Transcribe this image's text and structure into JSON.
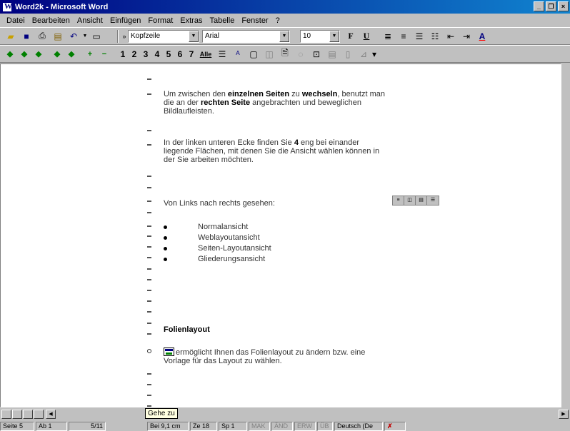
{
  "window": {
    "title": "Word2k - Microsoft Word"
  },
  "menu": [
    "Datei",
    "Bearbeiten",
    "Ansicht",
    "Einfügen",
    "Format",
    "Extras",
    "Tabelle",
    "Fenster",
    "?"
  ],
  "toolbar": {
    "style_value": "Kopfzeile",
    "font_value": "Arial",
    "size_value": "10",
    "bold_label": "F",
    "underline_label": "U",
    "outline_levels": [
      "1",
      "2",
      "3",
      "4",
      "5",
      "6",
      "7",
      "Alle"
    ]
  },
  "document": {
    "para1_pre": "Um zwischen den ",
    "para1_bold1": "einzelnen Seiten",
    "para1_mid": " zu ",
    "para1_bold2": "wechseln",
    "para1_post": ", benutzt man",
    "para1_line2_pre": "die an der ",
    "para1_line2_bold": "rechten Seite",
    "para1_line2_post": " angebrachten und beweglichen",
    "para1_line3": "Bildlaufleisten.",
    "para2_line1_pre": "In der linken unteren Ecke finden Sie ",
    "para2_line1_bold": "4",
    "para2_line1_post": " eng bei einander",
    "para2_line2": "liegende Flächen, mit denen Sie die Ansicht wählen können in",
    "para2_line3": "der Sie arbeiten möchten.",
    "para3": "Von Links nach rechts gesehen:",
    "bullets": [
      "Normalansicht",
      "Weblayoutansicht",
      "Seiten-Layoutansicht",
      "Gliederungsansicht"
    ],
    "heading": "Folienlayout",
    "para4_line1": "ermöglicht Ihnen das Folienlayout zu ändern bzw. eine",
    "para4_line2": "Vorlage für das Layout zu wählen."
  },
  "tooltip": "Gehe zu",
  "status": {
    "page": "Seite 5",
    "section": "Ab 1",
    "pages": "5/11",
    "position": "Bei 9,1 cm",
    "line": "Ze 18",
    "column": "Sp 1",
    "mak": "MAK",
    "aen": "ÄND",
    "erw": "ERW",
    "ub": "ÜB",
    "language": "Deutsch (De"
  }
}
